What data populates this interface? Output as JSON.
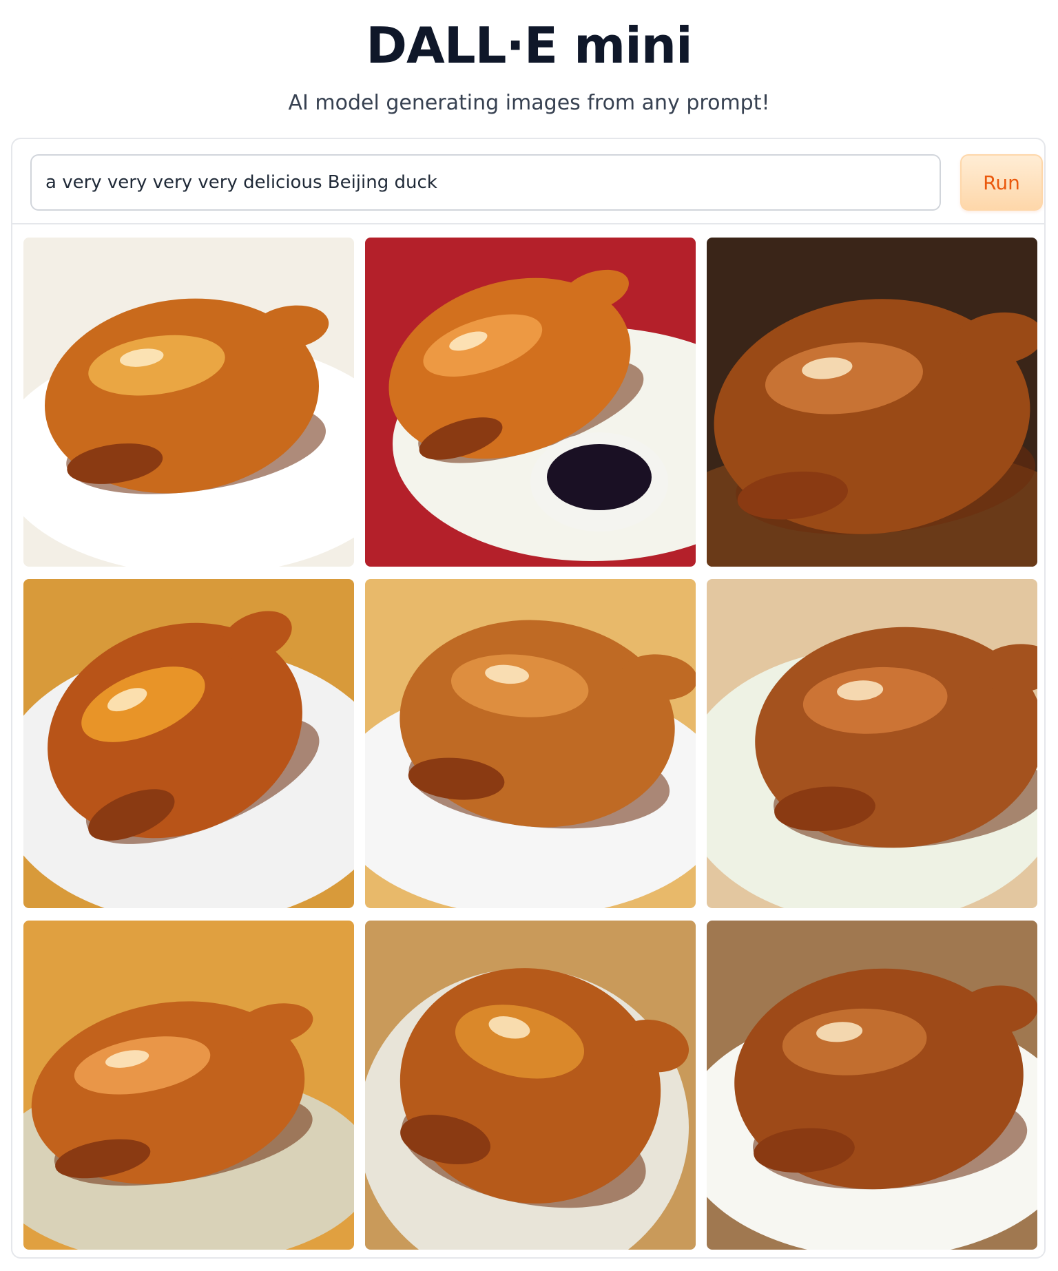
{
  "header": {
    "title": "DALL·E mini",
    "subtitle": "AI model generating images from any prompt!"
  },
  "prompt": {
    "value": "a very very very very delicious Beijing duck"
  },
  "run_button": {
    "label": "Run"
  },
  "colors": {
    "accent": "#ea580c",
    "accent_light": "#fed7aa",
    "title_text": "#0f1729",
    "border": "#e5e7eb"
  },
  "gallery": {
    "image_count": 9,
    "images": [
      {
        "name": "roast-duck-image-1",
        "bg": "#f3efe6"
      },
      {
        "name": "roast-duck-image-2",
        "bg": "#b4202a"
      },
      {
        "name": "roast-duck-image-3",
        "bg": "#3a2518"
      },
      {
        "name": "roast-duck-image-4",
        "bg": "#d89a3a"
      },
      {
        "name": "roast-duck-image-5",
        "bg": "#e8b96a"
      },
      {
        "name": "roast-duck-image-6",
        "bg": "#e3c7a0"
      },
      {
        "name": "roast-duck-image-7",
        "bg": "#e0a040"
      },
      {
        "name": "roast-duck-image-8",
        "bg": "#c99a5a"
      },
      {
        "name": "roast-duck-image-9",
        "bg": "#a07850"
      }
    ]
  }
}
